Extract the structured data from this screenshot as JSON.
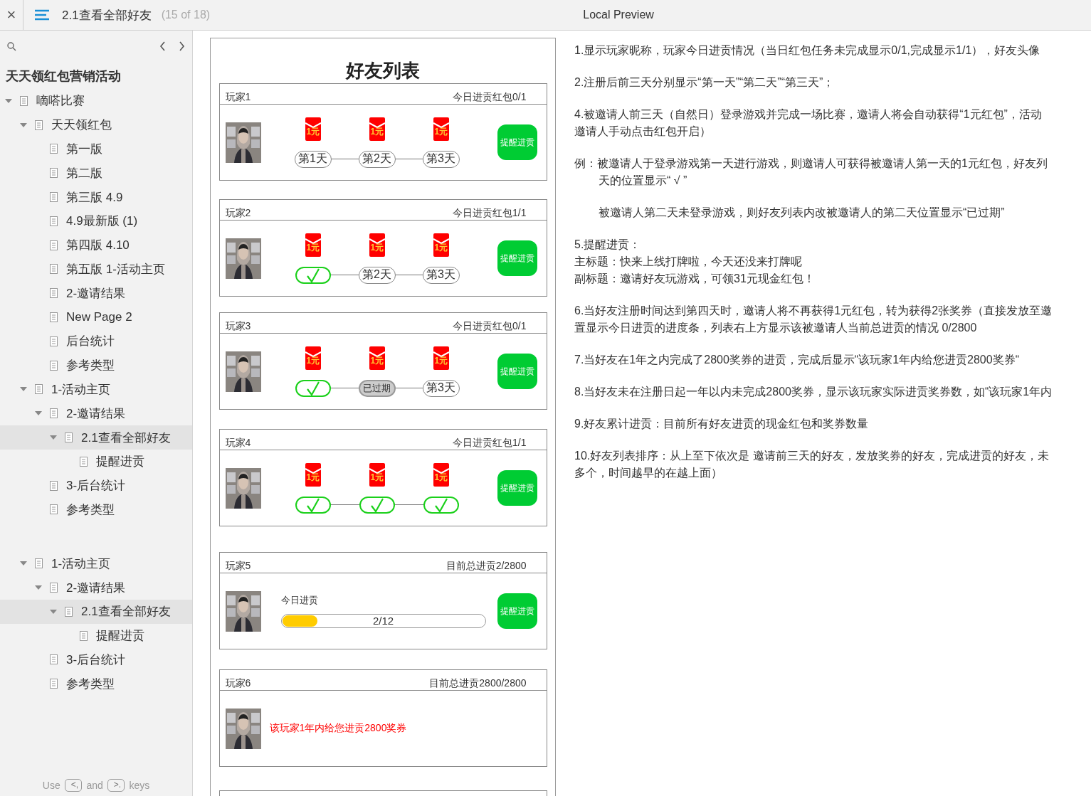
{
  "header": {
    "close": "×",
    "page_title": "2.1查看全部好友",
    "page_count": "(15 of 18)",
    "preview_title": "Local Preview"
  },
  "sidebar": {
    "project_title": "天天领红包营销活动",
    "tree": [
      {
        "label": "嘀嗒比赛",
        "expanded": true,
        "selected": false,
        "children": [
          {
            "label": "天天领红包",
            "expanded": true,
            "selected": false,
            "children": [
              {
                "label": "第一版",
                "selected": false
              },
              {
                "label": "第二版",
                "selected": false
              },
              {
                "label": "第三版 4.9",
                "selected": false
              },
              {
                "label": "4.9最新版 (1)",
                "selected": false
              },
              {
                "label": "第四版 4.10",
                "selected": false
              },
              {
                "label": "第五版 1-活动主页",
                "selected": false
              },
              {
                "label": "2-邀请结果",
                "selected": false
              },
              {
                "label": "New Page 2",
                "selected": false
              },
              {
                "label": "后台统计",
                "selected": false
              },
              {
                "label": "参考类型",
                "selected": false
              }
            ]
          },
          {
            "label": "1-活动主页",
            "expanded": true,
            "selected": false,
            "children": [
              {
                "label": "2-邀请结果",
                "expanded": true,
                "selected": false,
                "children": [
                  {
                    "label": "2.1查看全部好友",
                    "expanded": true,
                    "selected": true,
                    "children": [
                      {
                        "label": "提醒进贡",
                        "selected": false
                      }
                    ]
                  }
                ]
              },
              {
                "label": "3-后台统计",
                "selected": false
              },
              {
                "label": "参考类型",
                "selected": false
              }
            ]
          },
          {
            "label": "1-活动主页",
            "expanded": true,
            "selected": false,
            "spaced": true,
            "children": [
              {
                "label": "2-邀请结果",
                "expanded": true,
                "selected": false,
                "children": [
                  {
                    "label": "2.1查看全部好友",
                    "expanded": true,
                    "selected": true,
                    "children": [
                      {
                        "label": "提醒进贡",
                        "selected": false
                      }
                    ]
                  }
                ]
              },
              {
                "label": "3-后台统计",
                "selected": false
              },
              {
                "label": "参考类型",
                "selected": false
              }
            ]
          }
        ]
      }
    ],
    "footer": {
      "use": "Use",
      "prev_key": "<,",
      "and": "and",
      "next_key": ">.",
      "keys": "keys"
    }
  },
  "document": {
    "title": "好友列表",
    "cards": [
      {
        "kind": "days",
        "name": "玩家1",
        "stat": "今日进贡红包0/1",
        "button": "提醒进贡",
        "days": [
          {
            "envelope": "1元",
            "kind": "pending",
            "label": "第1天"
          },
          {
            "envelope": "1元",
            "kind": "pending",
            "label": "第2天"
          },
          {
            "envelope": "1元",
            "kind": "pending",
            "label": "第3天"
          }
        ]
      },
      {
        "kind": "days",
        "name": "玩家2",
        "stat": "今日进贡红包1/1",
        "button": "提醒进贡",
        "days": [
          {
            "envelope": "1元",
            "kind": "done"
          },
          {
            "envelope": "1元",
            "kind": "pending",
            "label": "第2天"
          },
          {
            "envelope": "1元",
            "kind": "pending",
            "label": "第3天"
          }
        ]
      },
      {
        "kind": "days",
        "name": "玩家3",
        "stat": "今日进贡红包0/1",
        "button": "提醒进贡",
        "days": [
          {
            "envelope": "1元",
            "kind": "done"
          },
          {
            "envelope": "1元",
            "kind": "expired",
            "label": "已过期"
          },
          {
            "envelope": "1元",
            "kind": "pending",
            "label": "第3天"
          }
        ]
      },
      {
        "kind": "days",
        "name": "玩家4",
        "stat": "今日进贡红包1/1",
        "button": "提醒进贡",
        "days": [
          {
            "envelope": "1元",
            "kind": "done"
          },
          {
            "envelope": "1元",
            "kind": "done"
          },
          {
            "envelope": "1元",
            "kind": "done"
          }
        ]
      },
      {
        "kind": "progress",
        "name": "玩家5",
        "stat": "目前总进贡2/2800",
        "button": "提醒进贡",
        "progress_label": "今日进贡",
        "level": 0.18,
        "reading": "2/12"
      },
      {
        "kind": "complete",
        "name": "玩家6",
        "stat": "目前总进贡2800/2800",
        "message": "该玩家1年内给您进贡2800奖券"
      },
      {
        "kind": "stub"
      }
    ]
  },
  "notes": [
    {
      "lines": [
        {
          "text": "1.显示玩家昵称，玩家今日进贡情况（当日红包任务未完成显示0/1,完成显示1/1），好友头像",
          "indent": false
        }
      ]
    },
    {
      "lines": [
        {
          "text": "2.注册后前三天分别显示“第一天”“第二天”“第三天”；",
          "indent": false
        }
      ]
    },
    {
      "lines": [
        {
          "text": "4.被邀请人前三天（自然日）登录游戏并完成一场比赛，邀请人将会自动获得“1元红包”，活动",
          "indent": false
        },
        {
          "text": "邀请人手动点击红包开启）",
          "indent": false
        }
      ]
    },
    {
      "lines": [
        {
          "text": "例：被邀请人于登录游戏第一天进行游戏，则邀请人可获得被邀请人第一天的1元红包，好友列",
          "indent": false
        },
        {
          "text": "天的位置显示“ √ ”",
          "indent": true
        }
      ]
    },
    {
      "lines": [
        {
          "text": "被邀请人第二天未登录游戏，则好友列表内改被邀请人的第二天位置显示“已过期”",
          "indent": true
        }
      ]
    },
    {
      "lines": [
        {
          "text": "5.提醒进贡：",
          "indent": false
        },
        {
          "text": "主标题：快来上线打牌啦，今天还没来打牌呢",
          "indent": false
        },
        {
          "text": "副标题：邀请好友玩游戏，可领31元现金红包！",
          "indent": false
        }
      ]
    },
    {
      "lines": [
        {
          "text": "6.当好友注册时间达到第四天时，邀请人将不再获得1元红包，转为获得2张奖券（直接发放至邀",
          "indent": false
        },
        {
          "text": "置显示今日进贡的进度条，列表右上方显示该被邀请人当前总进贡的情况 0/2800",
          "indent": false
        }
      ]
    },
    {
      "lines": [
        {
          "text": "7.当好友在1年之内完成了2800奖券的进贡，完成后显示“该玩家1年内给您进贡2800奖券“",
          "indent": false
        }
      ]
    },
    {
      "lines": [
        {
          "text": "8.当好友未在注册日起一年以内未完成2800奖券，显示该玩家实际进贡奖券数，如“该玩家1年内",
          "indent": false
        }
      ]
    },
    {
      "lines": [
        {
          "text": "9.好友累计进贡：目前所有好友进贡的现金红包和奖券数量",
          "indent": false
        }
      ]
    },
    {
      "lines": [
        {
          "text": "10.好友列表排序：从上至下依次是 邀请前三天的好友，发放奖券的好友，完成进贡的好友，未",
          "indent": false
        },
        {
          "text": "多个，时间越早的在越上面）",
          "indent": false
        }
      ]
    }
  ]
}
